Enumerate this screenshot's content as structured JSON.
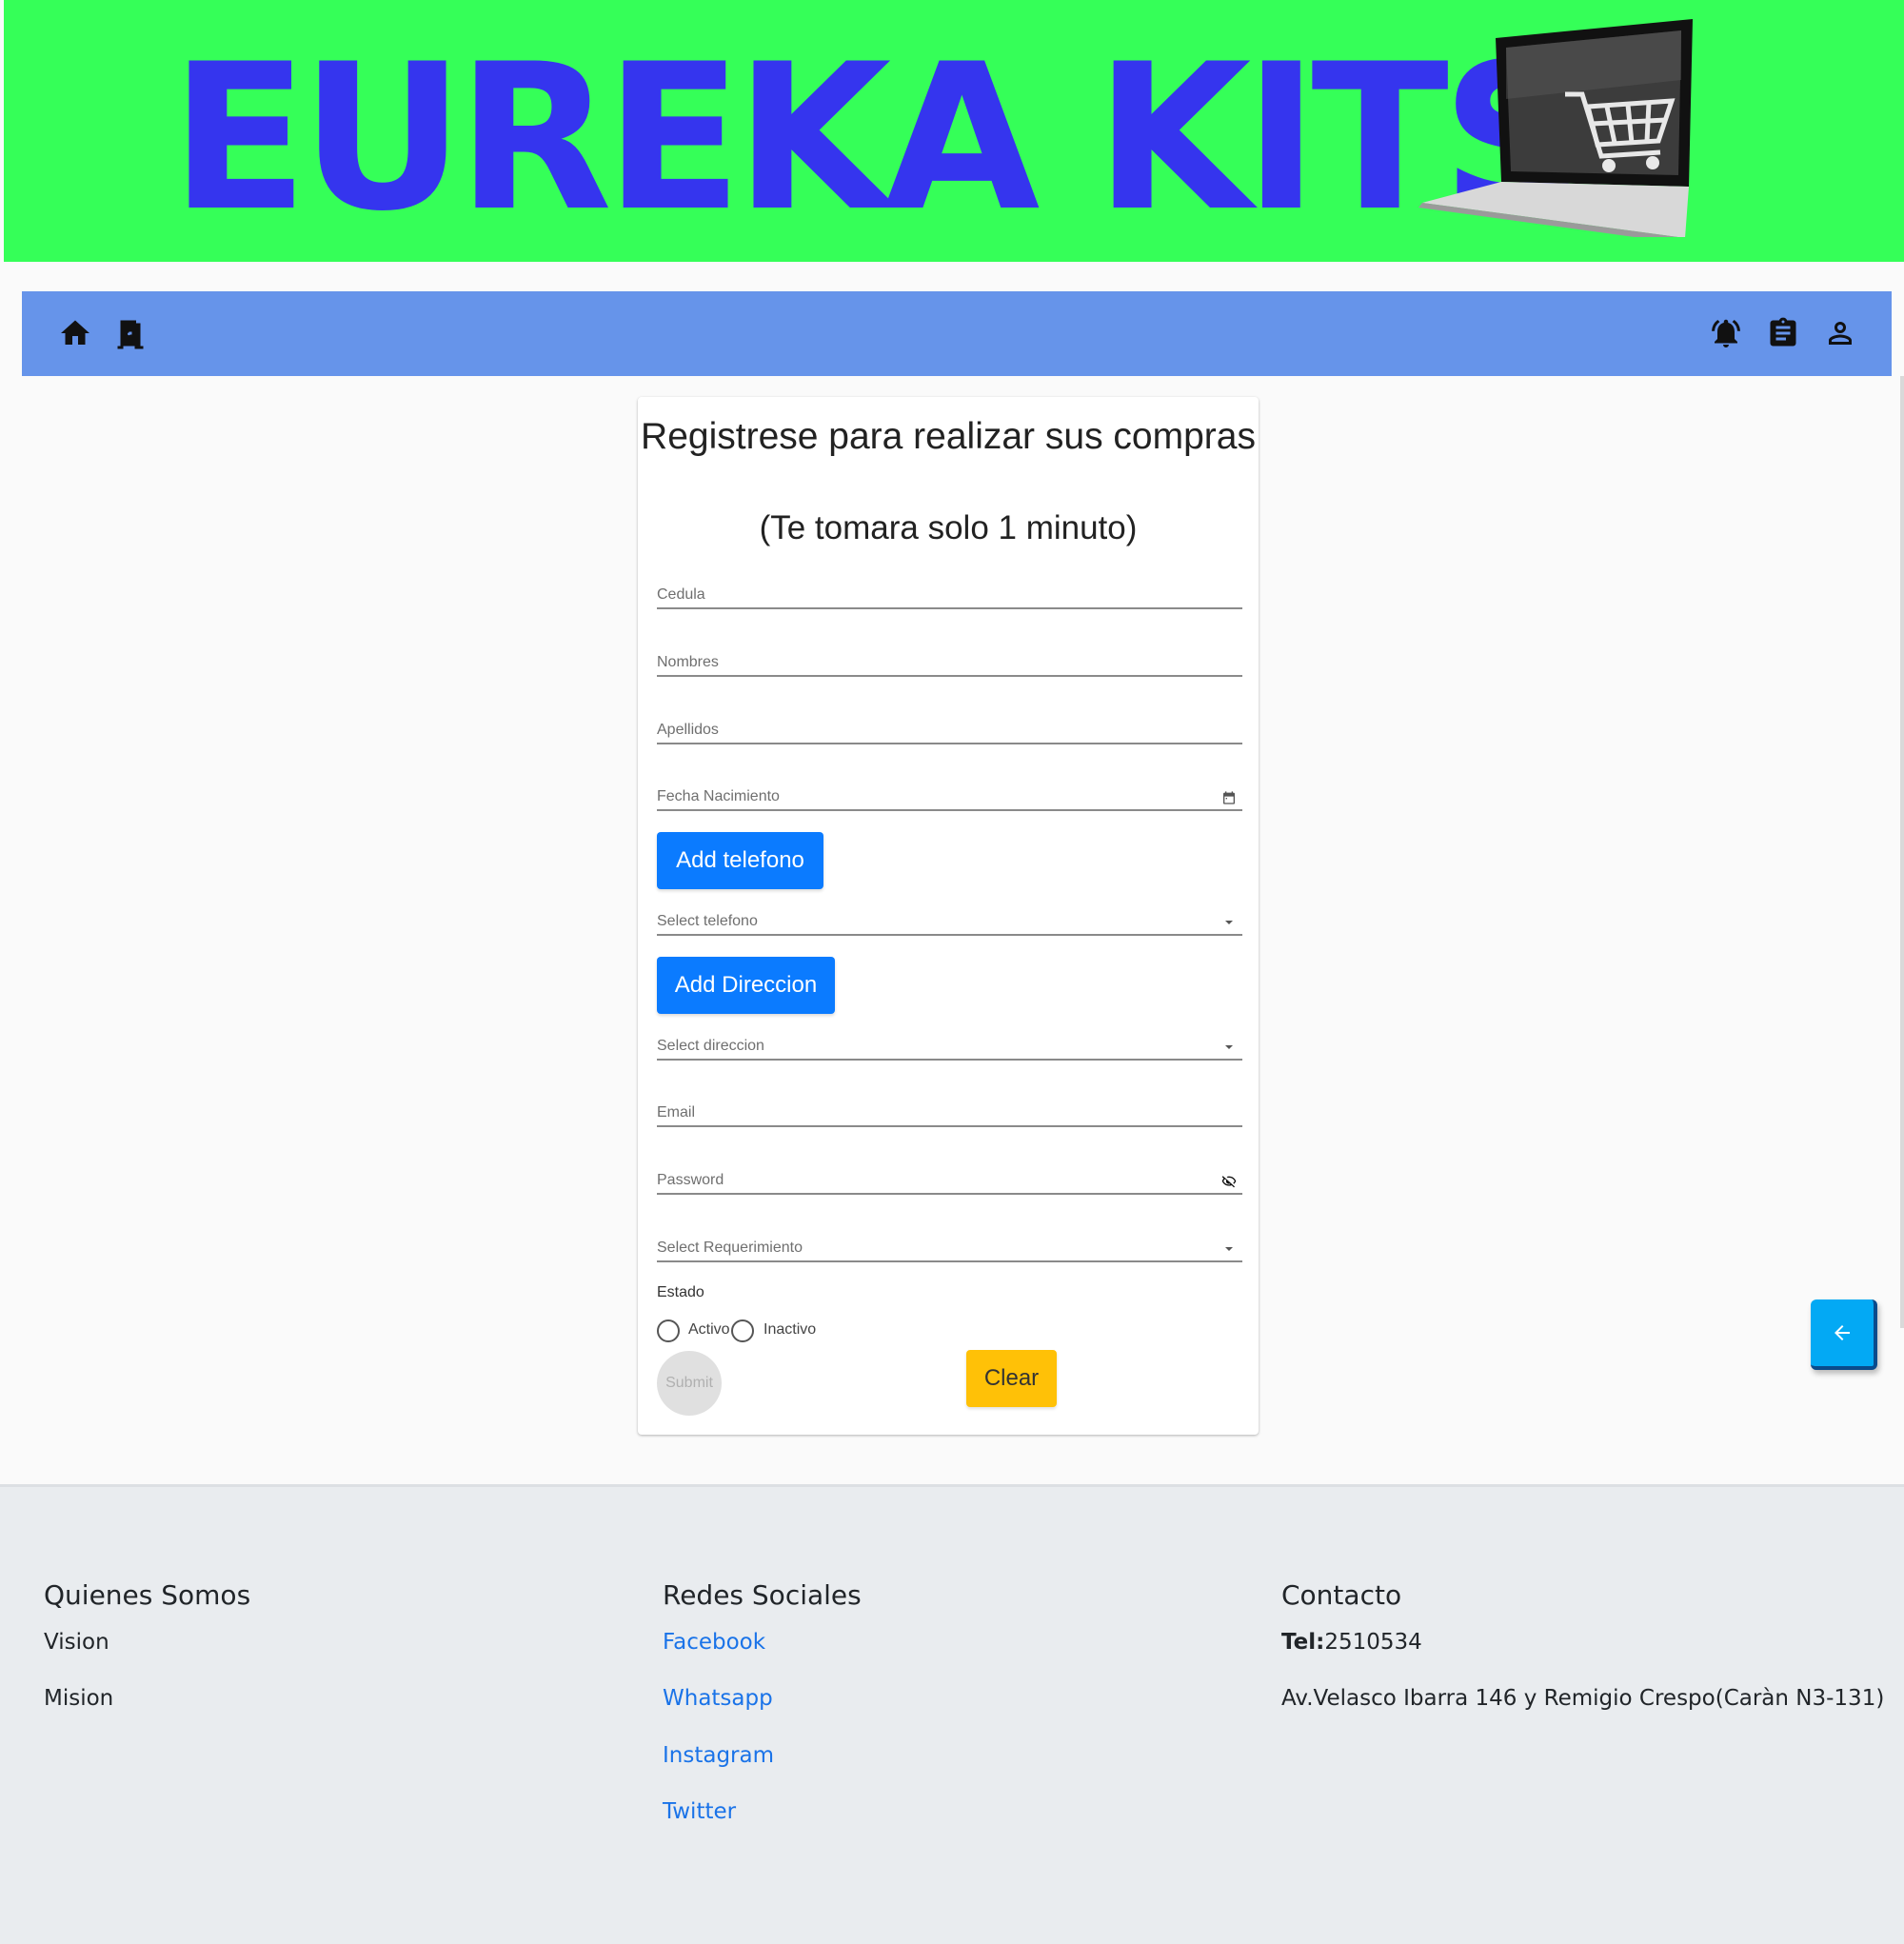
{
  "banner": {
    "title": "EUREKA KITS",
    "image": "laptop-shopping-cart-image",
    "bg_color": "#35ff58",
    "title_color": "#3535ee"
  },
  "navbar": {
    "bg_color": "#6694ea",
    "left_icons": [
      "home-icon",
      "exit-door-icon"
    ],
    "right_icons": [
      "notification-bell-icon",
      "clipboard-icon",
      "user-icon"
    ]
  },
  "form": {
    "title": "Registrese para realizar sus compras",
    "subtitle": "(Te tomara solo 1 minuto)",
    "fields": {
      "cedula": "Cedula",
      "nombres": "Nombres",
      "apellidos": "Apellidos",
      "fecha_nacimiento": "Fecha Nacimiento",
      "select_telefono": "Select telefono",
      "select_direccion": "Select direccion",
      "email": "Email",
      "password": "Password",
      "select_requerimiento": "Select Requerimiento"
    },
    "add_telefono": "Add telefono",
    "add_direccion": "Add Direccion",
    "estado_label": "Estado",
    "radio_activo": "Activo",
    "radio_inactivo": "Inactivo",
    "submit": "Submit",
    "clear": "Clear",
    "button_color": "#0b7bff",
    "clear_color": "#ffc107"
  },
  "fab": {
    "icon": "arrow-left-icon",
    "color": "#03a9f4"
  },
  "footer": {
    "about": {
      "heading": "Quienes Somos",
      "items": [
        "Vision",
        "Mision"
      ]
    },
    "social": {
      "heading": "Redes Sociales",
      "links": [
        "Facebook",
        "Whatsapp",
        "Instagram",
        "Twitter"
      ]
    },
    "contact": {
      "heading": "Contacto",
      "tel_label": "Tel:",
      "tel_value": "2510534",
      "address": "Av.Velasco Ibarra 146 y Remigio Crespo(Caràn N3-131)"
    }
  }
}
